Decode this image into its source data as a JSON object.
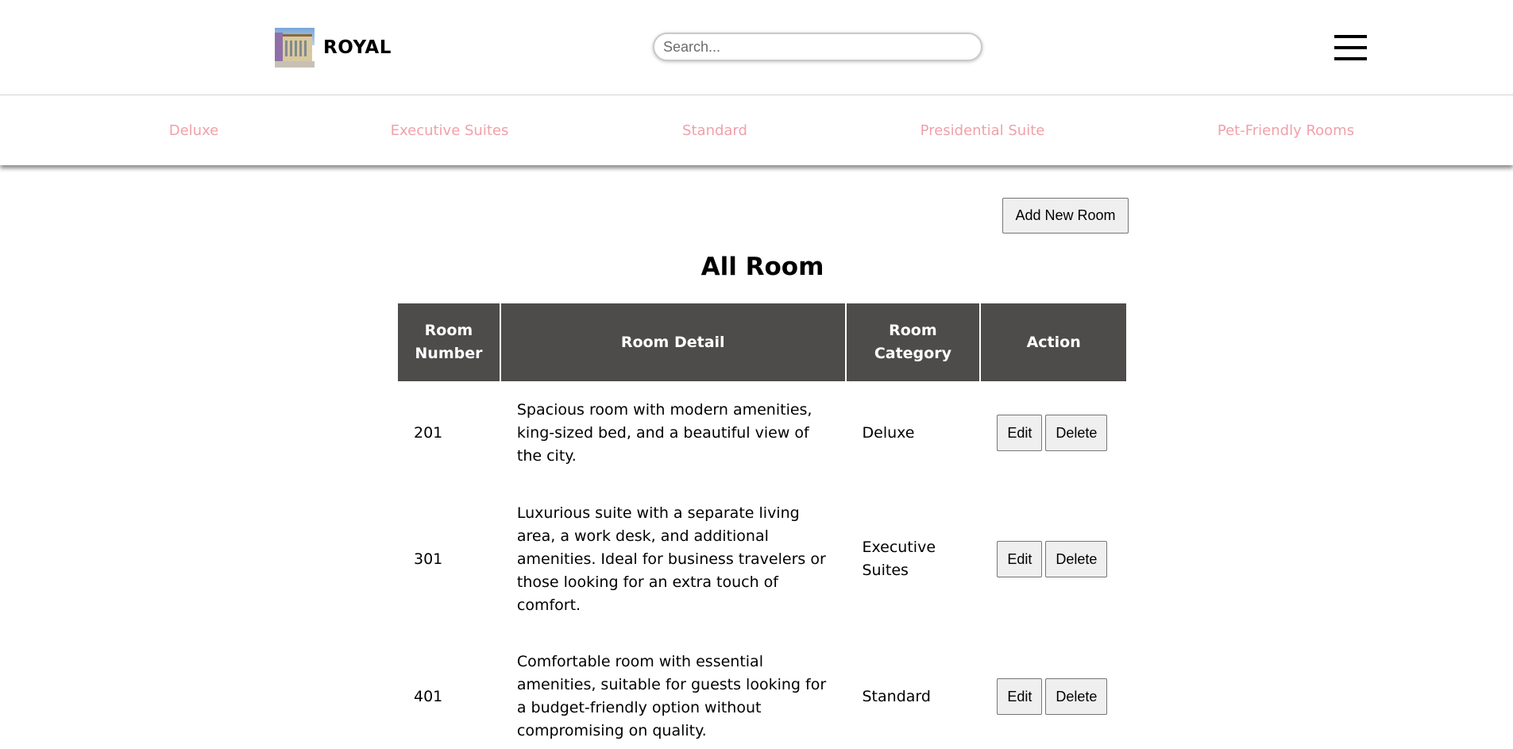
{
  "header": {
    "brand": "ROYAL",
    "search_placeholder": "Search..."
  },
  "categories": [
    "Deluxe",
    "Executive Suites",
    "Standard",
    "Presidential Suite",
    "Pet-Friendly Rooms"
  ],
  "main": {
    "add_button": "Add New Room",
    "title": "All Room",
    "columns": [
      "Room Number",
      "Room Detail",
      "Room Category",
      "Action"
    ],
    "rows": [
      {
        "number": "201",
        "detail": "Spacious room with modern amenities, king-sized bed, and a beautiful view of the city.",
        "category": "Deluxe",
        "edit": "Edit",
        "delete": "Delete"
      },
      {
        "number": "301",
        "detail": "Luxurious suite with a separate living area, a work desk, and additional amenities. Ideal for business travelers or those looking for an extra touch of comfort.",
        "category": "Executive Suites",
        "edit": "Edit",
        "delete": "Delete"
      },
      {
        "number": "401",
        "detail": "Comfortable room with essential amenities, suitable for guests looking for a budget-friendly option without compromising on quality.",
        "category": "Standard",
        "edit": "Edit",
        "delete": "Delete"
      }
    ]
  },
  "colors": {
    "header_bg": "#4e4b4b",
    "category_link": "#f0a1a9"
  }
}
